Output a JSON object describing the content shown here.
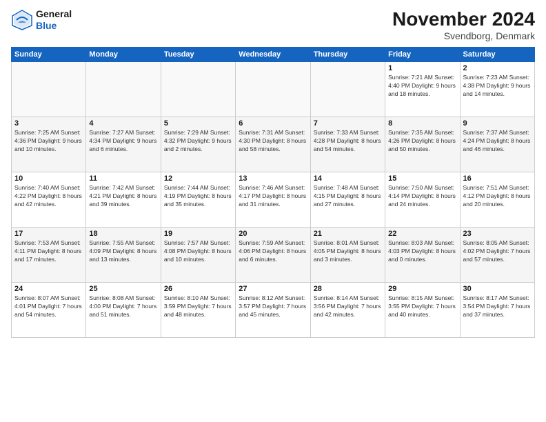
{
  "header": {
    "logo_general": "General",
    "logo_blue": "Blue",
    "title": "November 2024",
    "location": "Svendborg, Denmark"
  },
  "weekdays": [
    "Sunday",
    "Monday",
    "Tuesday",
    "Wednesday",
    "Thursday",
    "Friday",
    "Saturday"
  ],
  "weeks": [
    [
      {
        "day": "",
        "info": ""
      },
      {
        "day": "",
        "info": ""
      },
      {
        "day": "",
        "info": ""
      },
      {
        "day": "",
        "info": ""
      },
      {
        "day": "",
        "info": ""
      },
      {
        "day": "1",
        "info": "Sunrise: 7:21 AM\nSunset: 4:40 PM\nDaylight: 9 hours\nand 18 minutes."
      },
      {
        "day": "2",
        "info": "Sunrise: 7:23 AM\nSunset: 4:38 PM\nDaylight: 9 hours\nand 14 minutes."
      }
    ],
    [
      {
        "day": "3",
        "info": "Sunrise: 7:25 AM\nSunset: 4:36 PM\nDaylight: 9 hours\nand 10 minutes."
      },
      {
        "day": "4",
        "info": "Sunrise: 7:27 AM\nSunset: 4:34 PM\nDaylight: 9 hours\nand 6 minutes."
      },
      {
        "day": "5",
        "info": "Sunrise: 7:29 AM\nSunset: 4:32 PM\nDaylight: 9 hours\nand 2 minutes."
      },
      {
        "day": "6",
        "info": "Sunrise: 7:31 AM\nSunset: 4:30 PM\nDaylight: 8 hours\nand 58 minutes."
      },
      {
        "day": "7",
        "info": "Sunrise: 7:33 AM\nSunset: 4:28 PM\nDaylight: 8 hours\nand 54 minutes."
      },
      {
        "day": "8",
        "info": "Sunrise: 7:35 AM\nSunset: 4:26 PM\nDaylight: 8 hours\nand 50 minutes."
      },
      {
        "day": "9",
        "info": "Sunrise: 7:37 AM\nSunset: 4:24 PM\nDaylight: 8 hours\nand 46 minutes."
      }
    ],
    [
      {
        "day": "10",
        "info": "Sunrise: 7:40 AM\nSunset: 4:22 PM\nDaylight: 8 hours\nand 42 minutes."
      },
      {
        "day": "11",
        "info": "Sunrise: 7:42 AM\nSunset: 4:21 PM\nDaylight: 8 hours\nand 39 minutes."
      },
      {
        "day": "12",
        "info": "Sunrise: 7:44 AM\nSunset: 4:19 PM\nDaylight: 8 hours\nand 35 minutes."
      },
      {
        "day": "13",
        "info": "Sunrise: 7:46 AM\nSunset: 4:17 PM\nDaylight: 8 hours\nand 31 minutes."
      },
      {
        "day": "14",
        "info": "Sunrise: 7:48 AM\nSunset: 4:15 PM\nDaylight: 8 hours\nand 27 minutes."
      },
      {
        "day": "15",
        "info": "Sunrise: 7:50 AM\nSunset: 4:14 PM\nDaylight: 8 hours\nand 24 minutes."
      },
      {
        "day": "16",
        "info": "Sunrise: 7:51 AM\nSunset: 4:12 PM\nDaylight: 8 hours\nand 20 minutes."
      }
    ],
    [
      {
        "day": "17",
        "info": "Sunrise: 7:53 AM\nSunset: 4:11 PM\nDaylight: 8 hours\nand 17 minutes."
      },
      {
        "day": "18",
        "info": "Sunrise: 7:55 AM\nSunset: 4:09 PM\nDaylight: 8 hours\nand 13 minutes."
      },
      {
        "day": "19",
        "info": "Sunrise: 7:57 AM\nSunset: 4:08 PM\nDaylight: 8 hours\nand 10 minutes."
      },
      {
        "day": "20",
        "info": "Sunrise: 7:59 AM\nSunset: 4:06 PM\nDaylight: 8 hours\nand 6 minutes."
      },
      {
        "day": "21",
        "info": "Sunrise: 8:01 AM\nSunset: 4:05 PM\nDaylight: 8 hours\nand 3 minutes."
      },
      {
        "day": "22",
        "info": "Sunrise: 8:03 AM\nSunset: 4:03 PM\nDaylight: 8 hours\nand 0 minutes."
      },
      {
        "day": "23",
        "info": "Sunrise: 8:05 AM\nSunset: 4:02 PM\nDaylight: 7 hours\nand 57 minutes."
      }
    ],
    [
      {
        "day": "24",
        "info": "Sunrise: 8:07 AM\nSunset: 4:01 PM\nDaylight: 7 hours\nand 54 minutes."
      },
      {
        "day": "25",
        "info": "Sunrise: 8:08 AM\nSunset: 4:00 PM\nDaylight: 7 hours\nand 51 minutes."
      },
      {
        "day": "26",
        "info": "Sunrise: 8:10 AM\nSunset: 3:59 PM\nDaylight: 7 hours\nand 48 minutes."
      },
      {
        "day": "27",
        "info": "Sunrise: 8:12 AM\nSunset: 3:57 PM\nDaylight: 7 hours\nand 45 minutes."
      },
      {
        "day": "28",
        "info": "Sunrise: 8:14 AM\nSunset: 3:56 PM\nDaylight: 7 hours\nand 42 minutes."
      },
      {
        "day": "29",
        "info": "Sunrise: 8:15 AM\nSunset: 3:55 PM\nDaylight: 7 hours\nand 40 minutes."
      },
      {
        "day": "30",
        "info": "Sunrise: 8:17 AM\nSunset: 3:54 PM\nDaylight: 7 hours\nand 37 minutes."
      }
    ]
  ]
}
